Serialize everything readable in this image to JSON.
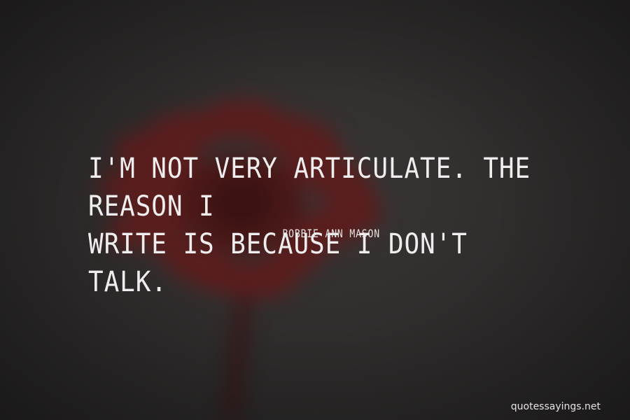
{
  "quote": {
    "text": "I'm not very articulate. The reason I\nwrite is because I don't talk.",
    "author": "- Bobbie Ann Mason"
  },
  "watermark": {
    "site": "quotessayings.net"
  },
  "colors": {
    "background": "#2e2c2c",
    "flower_petals": "#5a1e1e",
    "text": "#efeded"
  }
}
